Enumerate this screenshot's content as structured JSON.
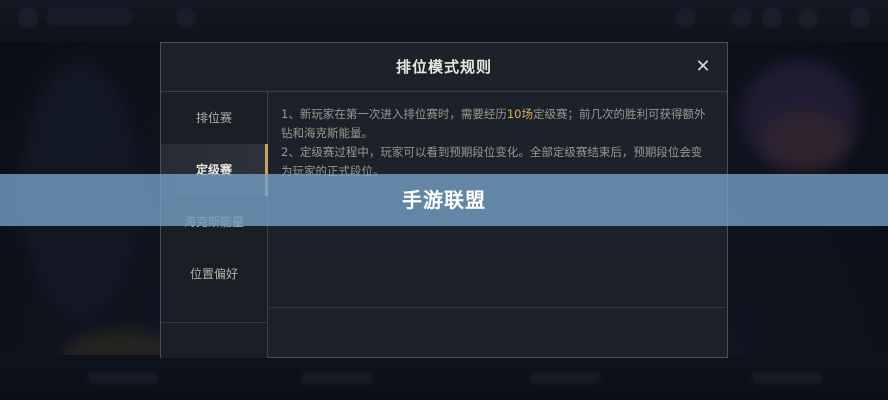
{
  "modal": {
    "title": "排位模式规则",
    "close_glyph": "✕"
  },
  "tabs": [
    {
      "label": "排位赛"
    },
    {
      "label": "定级赛",
      "active": true
    },
    {
      "label": "海克斯能量"
    },
    {
      "label": "位置偏好"
    }
  ],
  "content": {
    "line1_pre": "1、新玩家在第一次进入排位赛时，需要经历",
    "line1_highlight": "10场",
    "line1_post": "定级赛；前几次的胜利可获得额外钻和海克斯能量。",
    "line2": "2、定级赛过程中，玩家可以看到预期段位变化。全部定级赛结束后，预期段位会变为玩家的正式段位。"
  },
  "watermark": {
    "text": "手游联盟"
  },
  "colors": {
    "highlight": "#d9b45c",
    "active_tab_accent": "#c9a55b",
    "banner": "#76a0c5"
  }
}
